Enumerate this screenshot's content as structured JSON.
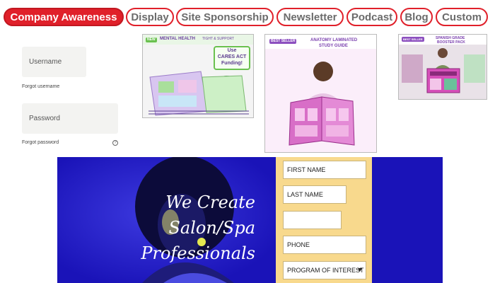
{
  "nav": {
    "tabs": [
      {
        "label": "Company Awareness",
        "active": true
      },
      {
        "label": "Display",
        "active": false
      },
      {
        "label": "Site Sponsorship",
        "active": false
      },
      {
        "label": "Newsletter",
        "active": false
      },
      {
        "label": "Podcast",
        "active": false
      },
      {
        "label": "Blog",
        "active": false
      },
      {
        "label": "Custom",
        "active": false
      }
    ]
  },
  "login": {
    "username_placeholder": "Username",
    "forgot_username": "Forgot username",
    "password_placeholder": "Password",
    "forgot_password": "Forgot password",
    "help_icon": "help-icon"
  },
  "products": {
    "mental_health": {
      "tag": "NEW",
      "title": "MENTAL HEALTH",
      "subtitle": "TIGHT & SUPPORT",
      "badge_line1": "Use",
      "badge_line2": "CARES ACT",
      "badge_line3": "Funding!"
    },
    "anatomy": {
      "tag": "BEST SELLER",
      "title_line1": "ANATOMY LAMINATED",
      "title_line2": "STUDY GUIDE"
    },
    "spanish": {
      "tag": "BEST SELLER",
      "title_line1": "SPANISH GRADE",
      "title_line2": "BOOSTER PACK"
    }
  },
  "hero": {
    "headline_line1": "We Create",
    "headline_line2": "Salon/Spa",
    "headline_line3": "Professionals",
    "form": {
      "first_name": "FIRST NAME",
      "last_name": "LAST NAME",
      "phone": "PHONE",
      "program": "PROGRAM OF INTEREST"
    }
  },
  "colors": {
    "accent_red": "#e0202a",
    "hero_blue": "#1a13b8",
    "form_yellow": "#f8d98d"
  }
}
